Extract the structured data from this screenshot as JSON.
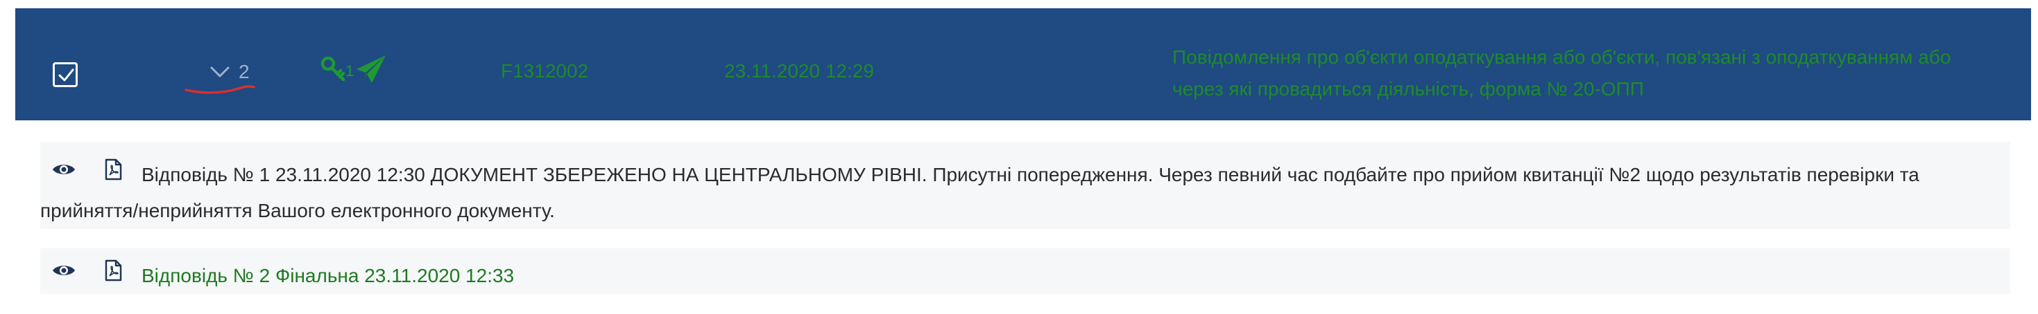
{
  "document": {
    "selected": true,
    "reply_count": "2",
    "key_count": "1",
    "code": "F1312002",
    "date": "23.11.2020 12:29",
    "title": "Повідомлення про об'єкти оподаткування або об'єкти, пов'язані з оподаткуванням або через які провадиться діяльність, форма № 20-ОПП"
  },
  "replies": [
    {
      "text": "Відповідь № 1 23.11.2020 12:30 ДОКУМЕНТ ЗБЕРЕЖЕНО НА ЦЕНТРАЛЬНОМУ РІВНІ. Присутні попередження. Через певний час подбайте про прийом квитанції №2 щодо результатів перевірки та прийняття/неприйняття Вашого електронного документу."
    },
    {
      "text": "Відповідь № 2 Фінальна 23.11.2020 12:33"
    }
  ],
  "icons": {
    "checkbox": "checkbox-checked-icon",
    "expander": "chevron-down-icon",
    "key": "key-icon",
    "sent": "paper-plane-icon",
    "view": "eye-icon",
    "pdf": "pdf-file-icon"
  },
  "colors": {
    "header_bg": "#1f4a82",
    "header_text": "#1f8a2c",
    "reply_bg": "#f5f7f9",
    "reply_final_text": "#1f7a20",
    "annotation": "#d9302b"
  }
}
